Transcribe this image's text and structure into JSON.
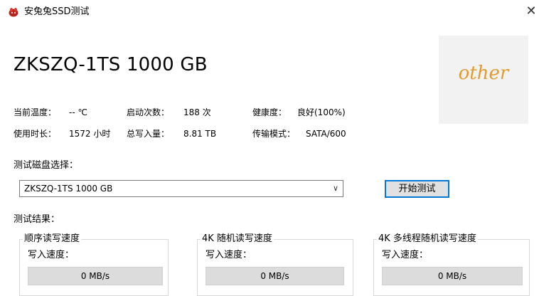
{
  "window": {
    "title": "安兔兔SSD测试",
    "app_icon": "antutu-icon",
    "close_glyph": "✕"
  },
  "disk": {
    "model": "ZKSZQ-1TS 1000 GB",
    "logo_text": "other"
  },
  "info": {
    "temperature_label": "当前温度：",
    "temperature_value": "-- ℃",
    "boot_count_label": "启动次数：",
    "boot_count_value": "188 次",
    "health_label": "健康度：",
    "health_value": "良好(100%)",
    "usage_time_label": "使用时长：",
    "usage_time_value": "1572 小时",
    "total_write_label": "总写入量：",
    "total_write_value": "8.81 TB",
    "transfer_mode_label": "传输模式：",
    "transfer_mode_value": "SATA/600"
  },
  "disk_select": {
    "label": "测试磁盘选择：",
    "selected": "ZKSZQ-1TS 1000 GB"
  },
  "start_button": "开始测试",
  "results": {
    "label": "测试结果：",
    "groups": [
      {
        "title": "顺序读写速度",
        "write_label": "写入速度：",
        "write_value": "0 MB/s"
      },
      {
        "title": "4K 随机读写速度",
        "write_label": "写入速度：",
        "write_value": "0 MB/s"
      },
      {
        "title": "4K 多线程随机读写速度",
        "write_label": "写入速度：",
        "write_value": "0 MB/s"
      }
    ]
  },
  "colors": {
    "accent": "#0078d7",
    "logo": "#e39a2e",
    "speed_box": "#dcdcdc"
  }
}
